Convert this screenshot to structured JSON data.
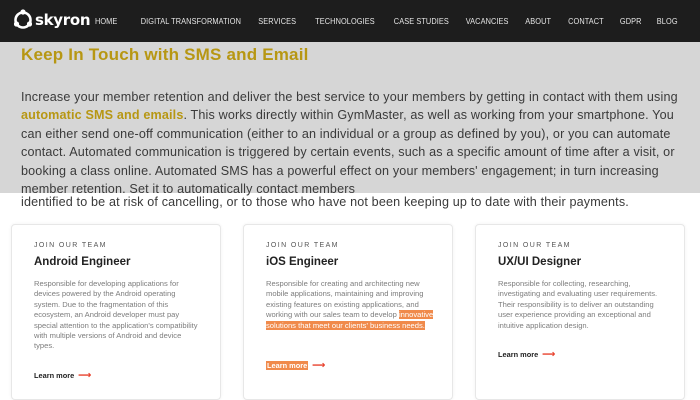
{
  "brand": {
    "name": "skyron"
  },
  "nav": {
    "items": [
      "HOME",
      "DIGITAL TRANSFORMATION",
      "SERVICES",
      "TECHNOLOGIES",
      "CASE STUDIES",
      "VACANCIES",
      "ABOUT",
      "CONTACT",
      "GDPR",
      "BLOG"
    ]
  },
  "intro": {
    "title": "Keep In Touch with SMS and Email",
    "body_1": "Increase your member retention and deliver the best service to your members by getting in contact with them using ",
    "highlight": "automatic SMS and emails",
    "body_2": ". This works directly within GymMaster, as well as working from your smartphone. You can either send one-off communication (either to an individual or a group as defined by you), or you can automate contact. Automated communication is triggered by certain events, such as a specific amount of time after a visit, or booking a class online. Automated SMS has a powerful effect on your members' engagement; in turn increasing member retention. Set it to automatically contact members",
    "body_3": "identified to be at risk of cancelling, or to those who have not been keeping up to date with their payments."
  },
  "cards": [
    {
      "kicker": "JOIN OUR TEAM",
      "title": "Android Engineer",
      "desc": "Responsible for developing applications for devices powered by the Android operating system. Due to the fragmentation of this ecosystem, an Android developer must pay special attention to the application's compatibility with multiple versions of Android and device types.",
      "link": "Learn more"
    },
    {
      "kicker": "JOIN OUR TEAM",
      "title": "iOS Engineer",
      "desc": "Responsible for creating and architecting new mobile applications, maintaining and improving existing features on existing applications, and working with our sales team to develop ",
      "desc_selected": "innovative solutions that meet our clients' business needs.",
      "link": "Learn more"
    },
    {
      "kicker": "JOIN OUR TEAM",
      "title": "UX/UI Designer",
      "desc": "Responsible for collecting, researching, investigating and evaluating user requirements. Their responsibility is to deliver an outstanding user experience providing an exceptional and intuitive application design.",
      "link": "Learn more"
    }
  ],
  "icons": {
    "arrow": "right-arrow-icon",
    "logo": "skyron-logo-icon"
  },
  "colors": {
    "nav_bg": "#1d1d1d",
    "accent_gold": "#b79713",
    "selection": "#f08a4b",
    "link_arrow": "#e8432f",
    "band_bg": "#d6d6d6"
  }
}
